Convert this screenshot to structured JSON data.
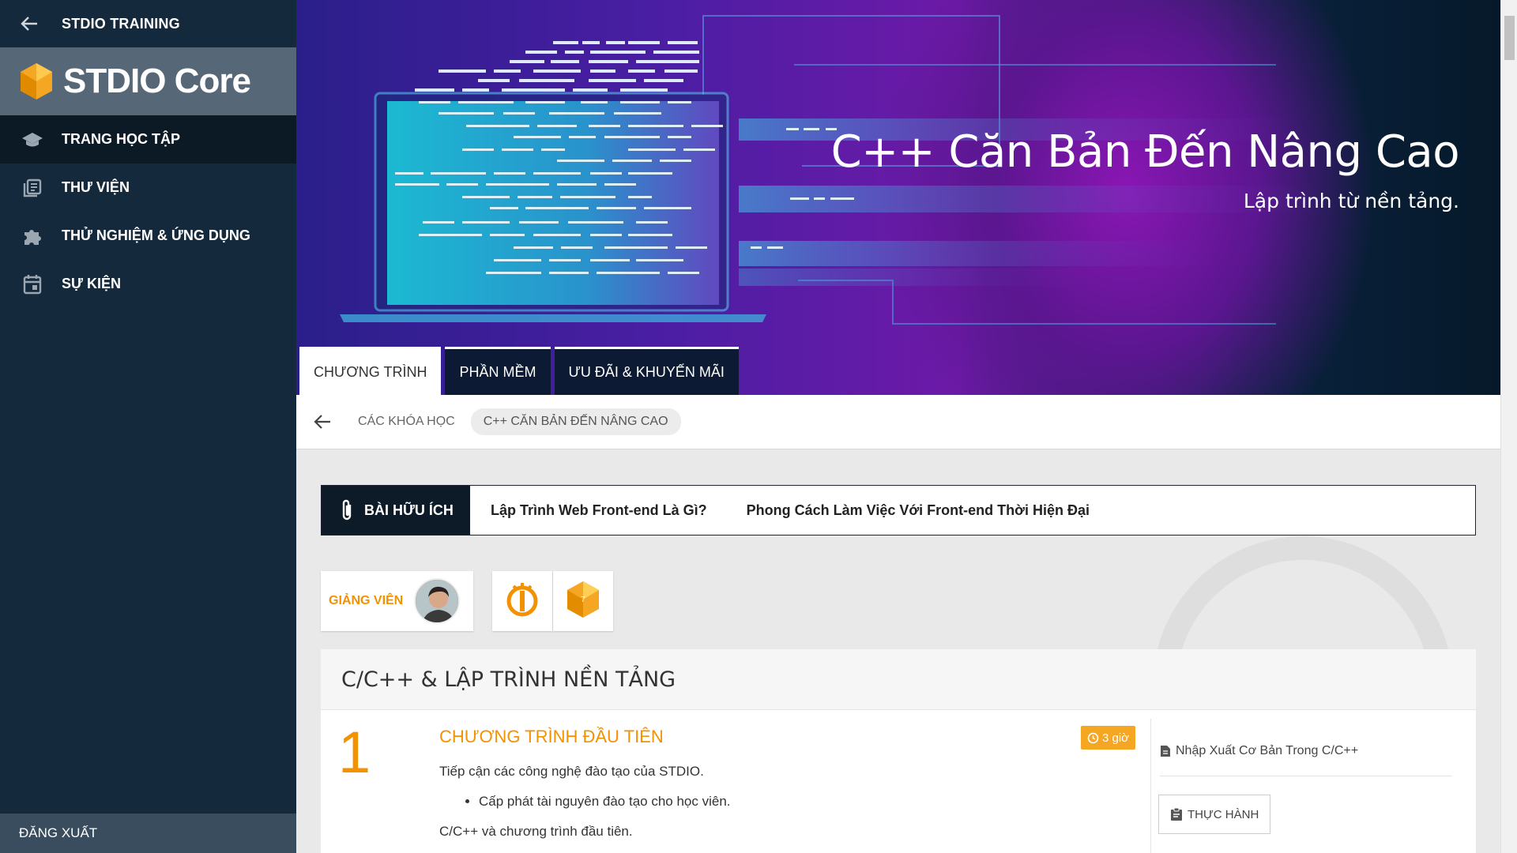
{
  "sidebar": {
    "top_title": "STDIO TRAINING",
    "brand": "STDIO Core",
    "items": [
      {
        "label": "TRANG HỌC TẬP",
        "icon": "graduation-cap-icon",
        "active": true
      },
      {
        "label": "THƯ VIỆN",
        "icon": "library-icon",
        "active": false
      },
      {
        "label": "THỬ NGHIỆM & ỨNG DỤNG",
        "icon": "puzzle-icon",
        "active": false
      },
      {
        "label": "SỰ KIỆN",
        "icon": "calendar-icon",
        "active": false
      }
    ],
    "logout": "ĐĂNG XUẤT"
  },
  "hero": {
    "title": "C++ Căn Bản Đến Nâng Cao",
    "subtitle": "Lập trình từ nền tảng."
  },
  "tabs": [
    {
      "label": "CHƯƠNG TRÌNH",
      "active": true
    },
    {
      "label": "PHẦN MỀM",
      "active": false
    },
    {
      "label": "ƯU ĐÃI & KHUYẾN MÃI",
      "active": false
    }
  ],
  "breadcrumb": {
    "parent": "CÁC KHÓA HỌC",
    "current": "C++ CĂN BẢN ĐẾN NÂNG CAO"
  },
  "useful": {
    "heading": "BÀI HỮU ÍCH",
    "links": [
      "Lập Trình Web Front-end Là Gì?",
      "Phong Cách Làm Việc Với Front-end Thời Hiện Đại"
    ]
  },
  "instructor": {
    "label": "GIẢNG VIÊN"
  },
  "course": {
    "section_title": "C/C++ & LẬP TRÌNH NỀN TẢNG",
    "lesson": {
      "number": "1",
      "title": "CHƯƠNG TRÌNH ĐẦU TIÊN",
      "duration": "3 giờ",
      "intro": "Tiếp cận các công nghệ đào tạo của STDIO.",
      "bullet": "Cấp phát tài nguyên đào tạo cho học viên.",
      "outro": "C/C++ và chương trình đầu tiên.",
      "link": "Nhập Xuất Cơ Bản Trong C/C++",
      "practice": "THỰC HÀNH"
    }
  },
  "colors": {
    "sidebar_bg": "#142a3c",
    "accent_orange": "#f39200",
    "time_badge": "#f5a623"
  }
}
